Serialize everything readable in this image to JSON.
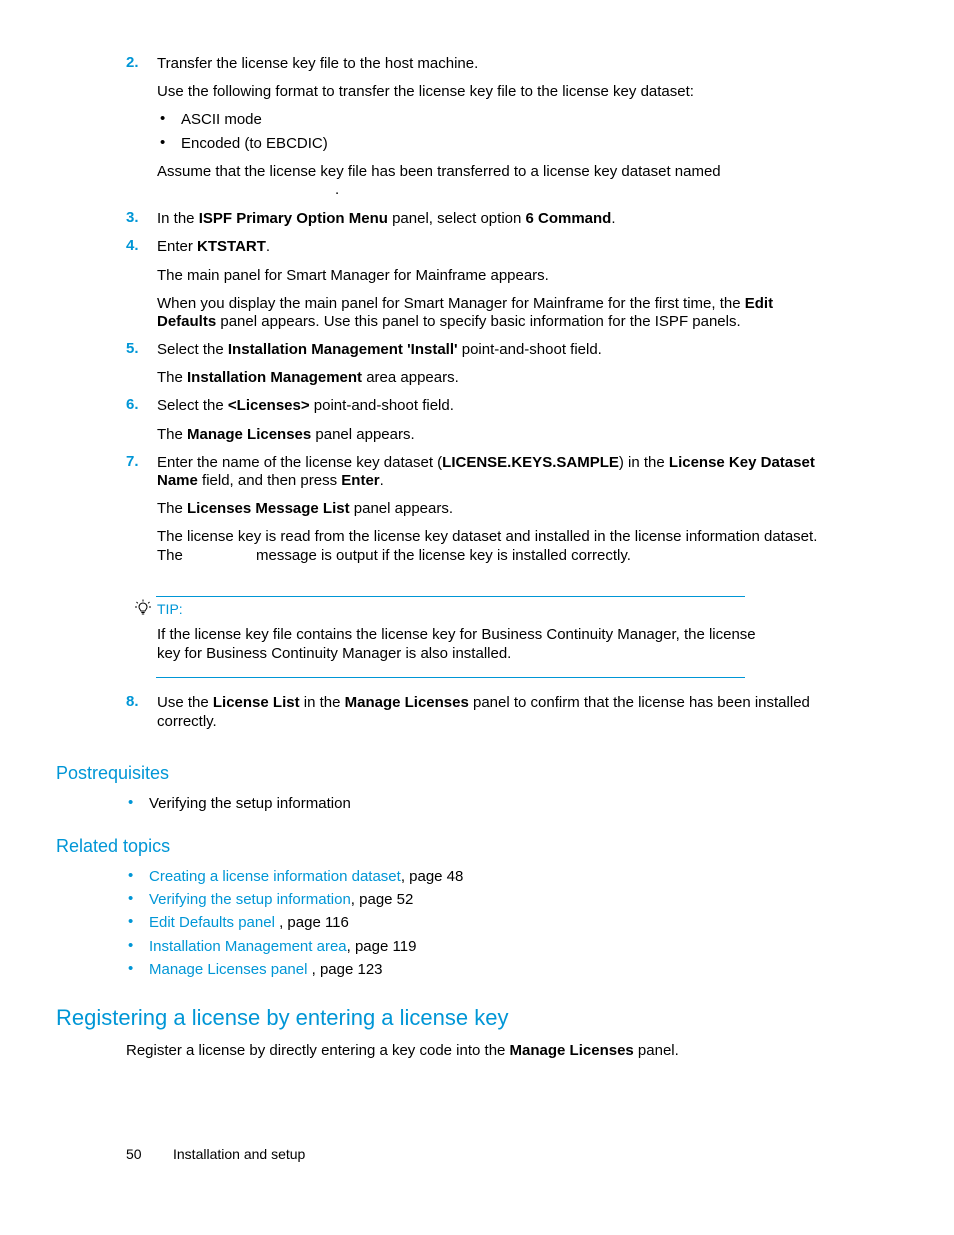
{
  "steps": [
    {
      "number": "2.",
      "text": "Transfer the license key file to the host machine.",
      "para1": "Use the following format to transfer the license key file to the license key dataset:",
      "bullets": [
        "ASCII mode",
        "Encoded (to EBCDIC)"
      ],
      "para2": "Assume that the license key file has been transferred to a license key dataset named",
      "para2_end": "."
    },
    {
      "number": "3.",
      "t1": "In the ",
      "b1": "ISPF Primary Option Menu",
      "t2": " panel, select option ",
      "b2": "6 Command",
      "t3": "."
    },
    {
      "number": "4.",
      "t1": "Enter ",
      "b1": "KTSTART",
      "t2": ".",
      "para1": "The main panel for Smart Manager for Mainframe appears.",
      "para2_t1": "When you display the main panel for Smart Manager for Mainframe for the first time, the ",
      "para2_b1": "Edit",
      "para2_b2": "Defaults",
      "para2_t2": " panel appears. Use this panel to specify basic information for the ISPF panels."
    },
    {
      "number": "5.",
      "t1": "Select the ",
      "b1": "Installation Management 'Install'",
      "t2": " point-and-shoot field.",
      "para_t1": "The ",
      "para_b1": "Installation Management",
      "para_t2": " area appears."
    },
    {
      "number": "6.",
      "t1": "Select the ",
      "b1": "<Licenses>",
      "t2": " point-and-shoot field.",
      "para_t1": "The ",
      "para_b1": "Manage Licenses",
      "para_t2": " panel appears."
    },
    {
      "number": "7.",
      "t1": "Enter the name of the license key dataset (",
      "b1": "LICENSE.KEYS.SAMPLE",
      "t2": ") in the ",
      "b2": "License Key Dataset",
      "b3": "Name",
      "t3": " field, and then press ",
      "b4": "Enter",
      "t4": ".",
      "para1_t1": "The ",
      "para1_b1": "Licenses Message List",
      "para1_t2": " panel appears.",
      "para2_line1": "The license key is read from the license key dataset and installed in the license information dataset.",
      "para2_line2a": "The",
      "para2_line2b": "message is output if the license key is installed correctly."
    },
    {
      "number": "8.",
      "t1": "Use the ",
      "b1": "License List",
      "t2": " in the ",
      "b2": "Manage Licenses",
      "t3": " panel to confirm that the license has been installed",
      "line2": "correctly."
    }
  ],
  "tip": {
    "icon": "lightbulb-icon",
    "label": "TIP:",
    "line1": "If the license key file contains the license key for Business Continuity Manager, the license",
    "line2": "key for Business Continuity Manager is also installed."
  },
  "postrequisites": {
    "heading": "Postrequisites",
    "items": [
      "Verifying the setup information"
    ]
  },
  "related_topics": {
    "heading": "Related topics",
    "items": [
      {
        "link": "Creating a license information dataset",
        "suffix": ", page 48"
      },
      {
        "link": "Verifying the setup information",
        "suffix": ", page 52"
      },
      {
        "link": "Edit Defaults panel ",
        "suffix": ", page 116"
      },
      {
        "link": "Installation Management area",
        "suffix": ", page 119"
      },
      {
        "link": "Manage Licenses panel ",
        "suffix": ", page 123"
      }
    ]
  },
  "section": {
    "heading": "Registering a license by entering a license key",
    "intro_t1": "Register a license by directly entering a key code into the ",
    "intro_b1": "Manage Licenses",
    "intro_t2": " panel."
  },
  "footer": {
    "page_number": "50",
    "chapter": "Installation and setup"
  },
  "colors": {
    "accent": "#0096d6"
  }
}
